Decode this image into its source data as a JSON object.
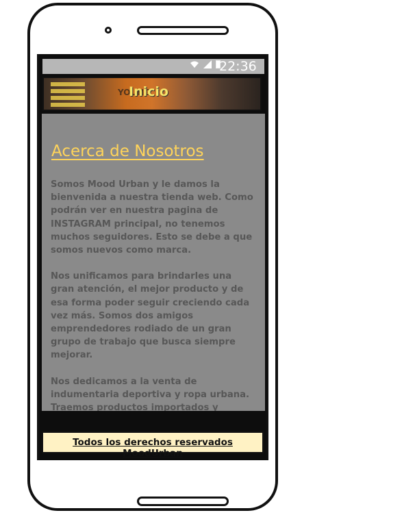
{
  "status_bar": {
    "time": "22:36",
    "icons": [
      "wifi-icon",
      "signal-icon",
      "battery-icon"
    ]
  },
  "header": {
    "title": "Inicio",
    "photo_text": "YOUNG",
    "menu_icon": "hamburger-menu-icon"
  },
  "about": {
    "heading": "Acerca de Nosotros",
    "paragraphs": [
      "Somos Mood Urban y le damos la bienvenida a nuestra tienda web. Como podrán ver en nuestra pagina de INSTAGRAM principal, no tenemos muchos seguidores. Esto se debe a que somos nuevos como marca.",
      "Nos unificamos para brindarles una gran atención, el mejor producto y de esa forma poder seguir creciendo cada vez más. Somos dos amigos emprendedores rodiado de un gran grupo de trabajo que busca siempre mejorar.",
      "Nos dedicamos a la venta de indumentaria deportiva y ropa urbana. Traemos productos importados y productos nacionales de buena calidad"
    ]
  },
  "footer": {
    "text": "Todos los derechos reservados MoodUrban"
  },
  "colors": {
    "heading": "#ffd45a",
    "content_bg": "#8a8a8a",
    "footer_bg": "#fff2c4",
    "title": "#f6e56a"
  }
}
